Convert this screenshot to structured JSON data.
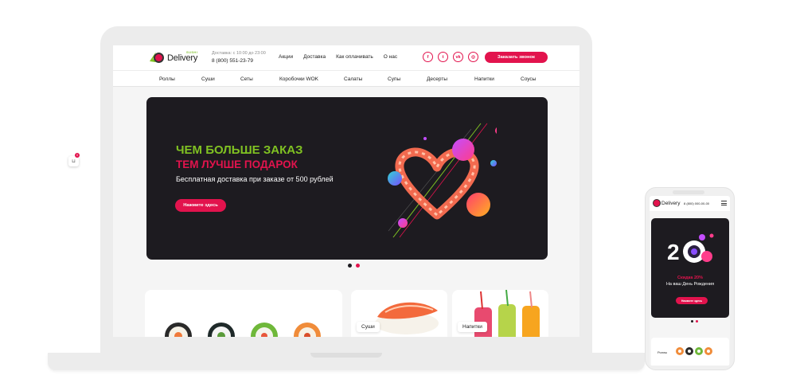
{
  "brand": {
    "name": "Delivery",
    "sub": "SUSHI",
    "accent": "#e2134d",
    "green": "#80c222"
  },
  "header": {
    "hours": "Доставка: с 10:00 до 23:00",
    "phone": "8 (800) 551-23-79",
    "nav": [
      "Акции",
      "Доставка",
      "Как оплачивать",
      "О нас"
    ],
    "socials": [
      {
        "icon": "facebook-icon",
        "glyph": "f"
      },
      {
        "icon": "twitter-icon",
        "glyph": "t"
      },
      {
        "icon": "vk-icon",
        "glyph": "vk"
      },
      {
        "icon": "instagram-icon",
        "glyph": "◎"
      }
    ],
    "callback_label": "Заказать звонок"
  },
  "categories": [
    "Роллы",
    "Суши",
    "Сеты",
    "Коробочки WOK",
    "Салаты",
    "Супы",
    "Десерты",
    "Напитки",
    "Соусы"
  ],
  "banner": {
    "line1": "ЧЕМ БОЛЬШЕ ЗАКАЗ",
    "line2": "ТЕМ ЛУЧШЕ ПОДАРОК",
    "line3": "Бесплатная доставка при заказе от 500 рублей",
    "button": "Нажмите здесь"
  },
  "slider": {
    "count": 2,
    "active": 1
  },
  "cards": [
    {
      "label": ""
    },
    {
      "label": "Суши"
    },
    {
      "label": "Напитки"
    }
  ],
  "mobile": {
    "phone": "8 (800) 000-00-00",
    "banner_line1": "Скидка 20%",
    "banner_line2": "На ваш День Рождения",
    "button": "Нажмите здесь",
    "card_label": "Роллы",
    "cart_count": "0"
  }
}
